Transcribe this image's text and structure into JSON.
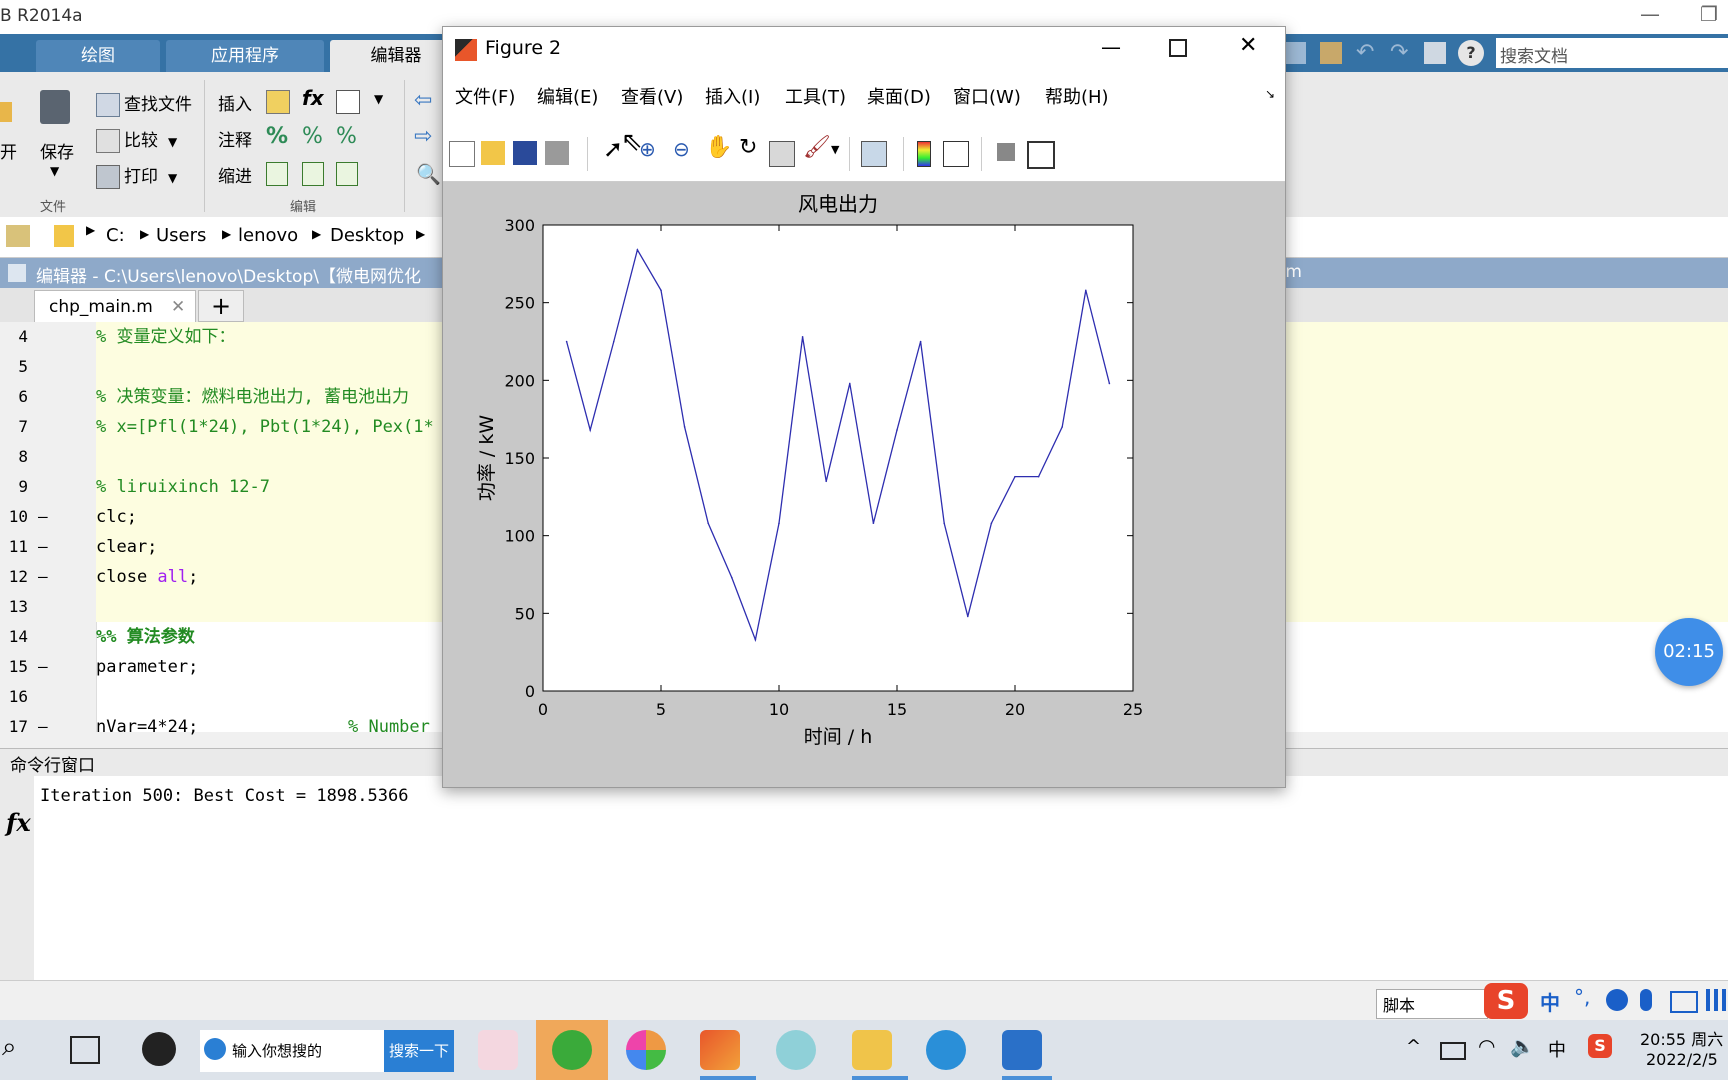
{
  "app": {
    "title": "B R2014a"
  },
  "ribbon": {
    "tabs": [
      "绘图",
      "应用程序",
      "编辑器"
    ],
    "file": {
      "open": "开",
      "save": "保存",
      "find_files": "查找文件",
      "compare": "比较",
      "print": "打印",
      "group": "文件"
    },
    "edit": {
      "insert": "插入",
      "comment": "注释",
      "indent": "缩进",
      "group": "编辑"
    },
    "search_placeholder": "搜索文档"
  },
  "address": [
    "C:",
    "Users",
    "lenovo",
    "Desktop"
  ],
  "editor": {
    "title": "编辑器 - C:\\Users\\lenovo\\Desktop\\【微电网优化",
    "title_tail": ".m",
    "file_tab": "chp_main.m",
    "lines": [
      {
        "n": "4",
        "dash": "",
        "text": "% 变量定义如下：",
        "kind": "cmt",
        "cell": true
      },
      {
        "n": "5",
        "dash": "",
        "text": "",
        "kind": "plain",
        "cell": true
      },
      {
        "n": "6",
        "dash": "",
        "text": "% 决策变量：燃料电池出力, 蓄电池出力",
        "kind": "cmt",
        "cell": true
      },
      {
        "n": "7",
        "dash": "",
        "text": "% x=[Pfl(1*24), Pbt(1*24), Pex(1*",
        "kind": "cmt",
        "cell": true
      },
      {
        "n": "8",
        "dash": "",
        "text": "",
        "kind": "plain",
        "cell": true
      },
      {
        "n": "9",
        "dash": "",
        "text": "% liruixinch 12-7",
        "kind": "cmt",
        "cell": true
      },
      {
        "n": "10",
        "dash": "—",
        "text": "clc;",
        "kind": "plain",
        "cell": true
      },
      {
        "n": "11",
        "dash": "—",
        "text": "clear;",
        "kind": "plain",
        "cell": true
      },
      {
        "n": "12",
        "dash": "—",
        "text": "close all;",
        "kind": "close",
        "cell": true
      },
      {
        "n": "13",
        "dash": "",
        "text": "",
        "kind": "plain",
        "cell": true
      },
      {
        "n": "14",
        "dash": "",
        "text": "%% 算法参数",
        "kind": "cmtb",
        "cell": false
      },
      {
        "n": "15",
        "dash": "—",
        "text": "parameter;",
        "kind": "plain",
        "cell": false
      },
      {
        "n": "16",
        "dash": "",
        "text": "",
        "kind": "plain",
        "cell": false
      },
      {
        "n": "17",
        "dash": "—",
        "text": "nVar=4*24;",
        "kind": "nvar",
        "cell": false
      }
    ],
    "line17_comment": "% Number"
  },
  "command": {
    "header": "命令行窗口",
    "output": "Iteration 500: Best Cost = 1898.5366",
    "fx": "fx"
  },
  "status": {
    "mode": "脚本"
  },
  "ime": {
    "lang": "中"
  },
  "timer": "02:15",
  "taskbar": {
    "search_placeholder": "输入你想搜的",
    "search_button": "搜索一下",
    "time": "20:55 周六",
    "date": "2022/2/5",
    "tray_lang": "中"
  },
  "figure": {
    "title": "Figure 2",
    "menu": [
      "文件(F)",
      "编辑(E)",
      "查看(V)",
      "插入(I)",
      "工具(T)",
      "桌面(D)",
      "窗口(W)",
      "帮助(H)"
    ]
  },
  "chart_data": {
    "type": "line",
    "title": "风电出力",
    "xlabel": "时间 / h",
    "ylabel": "功率 / kW",
    "xlim": [
      0,
      25
    ],
    "ylim": [
      0,
      300
    ],
    "xticks": [
      0,
      5,
      10,
      15,
      20,
      25
    ],
    "yticks": [
      0,
      50,
      100,
      150,
      200,
      250,
      300
    ],
    "grid": false,
    "line_color": "#2e2eb0",
    "x": [
      1,
      2,
      3,
      4,
      5,
      6,
      7,
      8,
      9,
      10,
      11,
      12,
      13,
      14,
      15,
      16,
      17,
      18,
      19,
      20,
      21,
      22,
      23,
      24
    ],
    "y": [
      225,
      168,
      225,
      284,
      258,
      170,
      108,
      73,
      33,
      108,
      228,
      135,
      198,
      108,
      168,
      225,
      108,
      48,
      108,
      138,
      138,
      170,
      258,
      198
    ]
  }
}
